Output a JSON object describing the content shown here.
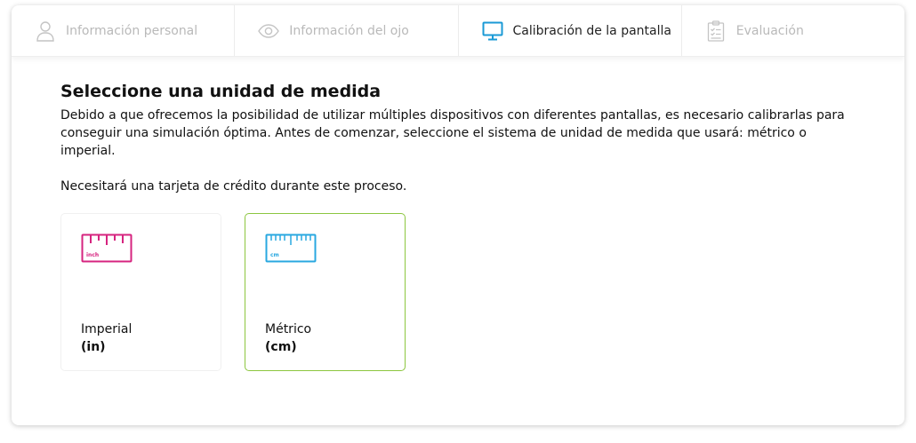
{
  "tabs": [
    {
      "label": "Información personal",
      "icon": "user-icon",
      "active": false
    },
    {
      "label": "Información del ojo",
      "icon": "eye-icon",
      "active": false
    },
    {
      "label": "Calibración de la pantalla",
      "icon": "monitor-icon",
      "active": true
    },
    {
      "label": "Evaluación",
      "icon": "clipboard-checklist-icon",
      "active": false
    }
  ],
  "main": {
    "title": "Seleccione una unidad de medida",
    "description": "Debido a que ofrecemos la posibilidad de utilizar múltiples dispositivos con diferentes pantallas, es necesario calibrarlas para conseguir una simulación óptima. Antes de comenzar, seleccione el sistema de unidad de medida que usará: métrico o imperial.",
    "note": "Necesitará una tarjeta de crédito durante este proceso."
  },
  "options": [
    {
      "name": "Imperial",
      "unit": "(in)",
      "ruler_label": "inch",
      "icon": "ruler-inch-icon",
      "selected": false
    },
    {
      "name": "Métrico",
      "unit": "(cm)",
      "ruler_label": "cm",
      "icon": "ruler-cm-icon",
      "selected": true
    }
  ],
  "colors": {
    "active_tab_icon": "#1a9ad6",
    "imperial_ruler": "#d6247f",
    "metric_ruler": "#29a8e0",
    "selected_border": "#8cc63f",
    "inactive_text": "#b9b9b9"
  }
}
